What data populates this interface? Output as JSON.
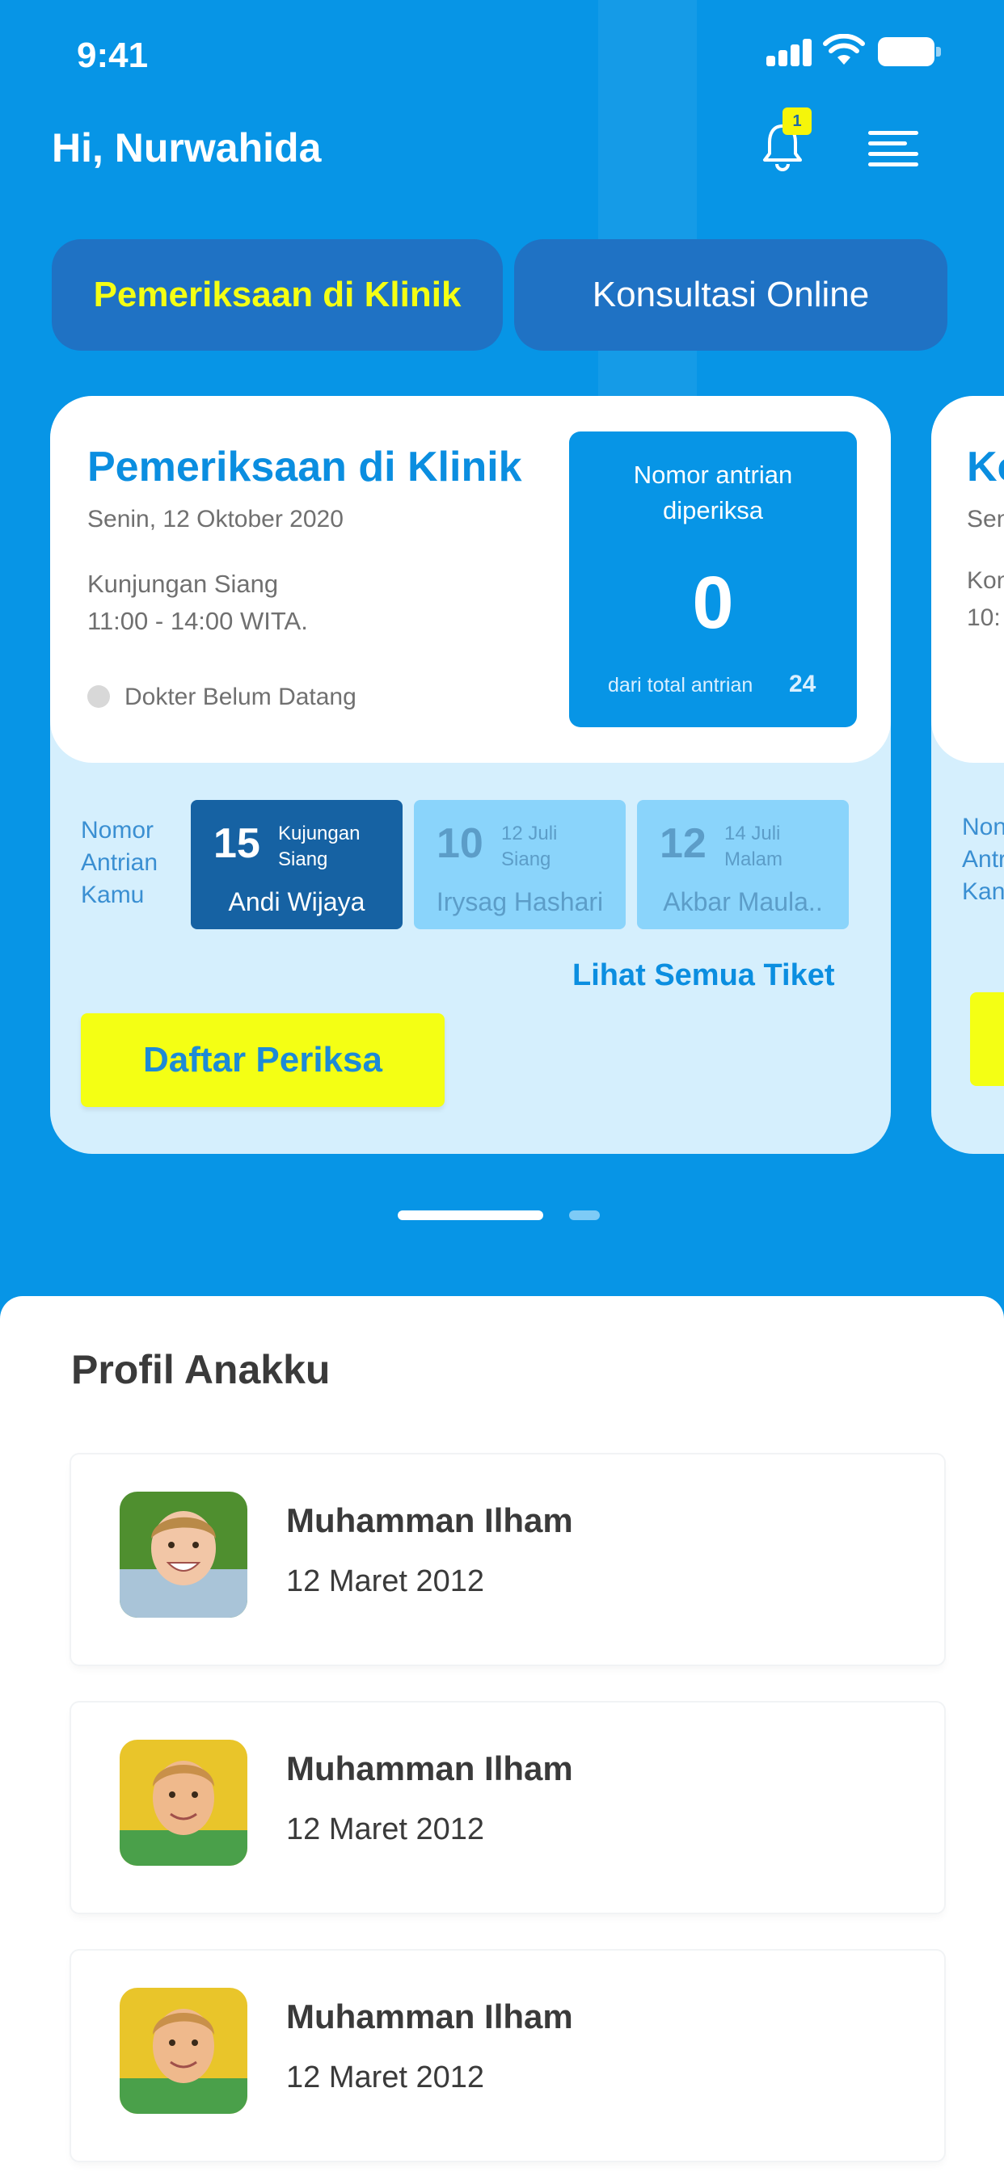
{
  "status_bar": {
    "time": "9:41"
  },
  "header": {
    "greeting": "Hi, Nurwahida",
    "notification_count": "1"
  },
  "tabs": [
    {
      "label": "Pemeriksaan di Klinik",
      "active": true
    },
    {
      "label": "Konsultasi Online",
      "active": false
    }
  ],
  "card": {
    "title": "Pemeriksaan di Klinik",
    "date": "Senin, 12 Oktober 2020",
    "visit_type": "Kunjungan Siang",
    "visit_time": "11:00 - 14:00 WITA.",
    "doctor_status": "Dokter Belum Datang",
    "queue_label_line1": "Nomor antrian",
    "queue_label_line2": "diperiksa",
    "queue_number": "0",
    "queue_total_label": "dari total antrian",
    "queue_total": "24",
    "my_queue_line1": "Nomor",
    "my_queue_line2": "Antrian",
    "my_queue_line3": "Kamu",
    "tickets": [
      {
        "number": "15",
        "sub1": "Kujungan",
        "sub2": "Siang",
        "name": "Andi Wijaya"
      },
      {
        "number": "10",
        "sub1": "12 Juli",
        "sub2": "Siang",
        "name": "Irysag Hashari"
      },
      {
        "number": "12",
        "sub1": "14 Juli",
        "sub2": "Malam",
        "name": "Akbar Maula.."
      }
    ],
    "see_all": "Lihat Semua Tiket",
    "register_button": "Daftar Periksa"
  },
  "peek_card": {
    "title": "Ko",
    "date": "Sen",
    "visit_type": "Kon",
    "visit_time": "10:",
    "my_queue_line1": "Non",
    "my_queue_line2": "Antr",
    "my_queue_line3": "Kan"
  },
  "profiles": {
    "title": "Profil Anakku",
    "children": [
      {
        "name": "Muhamman Ilham",
        "dob": "12 Maret 2012"
      },
      {
        "name": "Muhamman Ilham",
        "dob": "12 Maret 2012"
      },
      {
        "name": "Muhamman Ilham",
        "dob": "12 Maret 2012"
      }
    ]
  },
  "colors": {
    "primary": "#0795e6",
    "accent_yellow": "#f4ff14",
    "dark_blue": "#1662a3",
    "light_blue_bg": "#d5effd"
  },
  "icons": [
    "signal-icon",
    "wifi-icon",
    "battery-icon",
    "bell-icon",
    "menu-icon"
  ]
}
